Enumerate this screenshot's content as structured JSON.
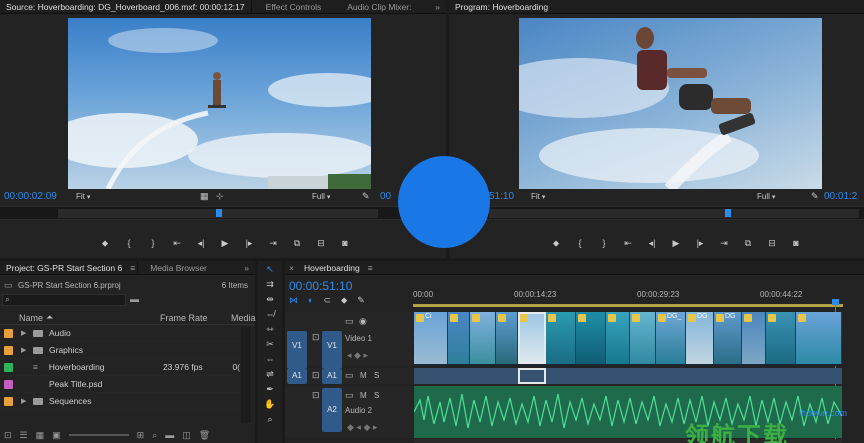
{
  "source_monitor": {
    "tab_title": "Source: Hoverboarding: DG_Hoverboard_006.mxf: 00:00:12:17",
    "tab_effect_controls": "Effect Controls",
    "tab_audio_clip_mixer": "Audio Clip Mixer:",
    "more": "»",
    "timecode": "00:00:02:09",
    "fit_label": "Fit",
    "full_label": "Full",
    "duration_partial": "00"
  },
  "program_monitor": {
    "tab_title": "Program: Hoverboarding",
    "timecode_partial": "51:10",
    "fit_label": "Fit",
    "full_label": "Full",
    "duration_partial": "00:01:2"
  },
  "transport_icons": [
    "marker-icon",
    "in-point-icon",
    "out-point-icon",
    "go-to-in-icon",
    "step-back-icon",
    "play-icon",
    "step-forward-icon",
    "go-to-out-icon",
    "insert-icon",
    "overwrite-icon",
    "export-frame-icon"
  ],
  "project": {
    "tab_title": "Project: GS-PR Start Section 6",
    "tab_media_browser": "Media Browser",
    "filename": "GS-PR Start Section 6.prproj",
    "item_count": "6 Items",
    "col_name": "Name",
    "col_frame_rate": "Frame Rate",
    "col_media": "Media",
    "items": [
      {
        "name": "Audio",
        "type": "folder",
        "color": "#e8a03c",
        "rate": "",
        "extra": ""
      },
      {
        "name": "Graphics",
        "type": "folder",
        "color": "#e8a03c",
        "rate": "",
        "extra": ""
      },
      {
        "name": "Hoverboarding",
        "type": "sequence",
        "color": "#2fb35a",
        "rate": "23.976 fps",
        "extra": "0("
      },
      {
        "name": "Peak Title.psd",
        "type": "file",
        "color": "#c45ec0",
        "rate": "",
        "extra": ""
      },
      {
        "name": "Sequences",
        "type": "folder",
        "color": "#e8a03c",
        "rate": "",
        "extra": ""
      }
    ]
  },
  "timeline": {
    "tab_title": "Hoverboarding",
    "timecode": "00:00:51:10",
    "ruler": [
      "00:00",
      "00:00:14:23",
      "00:00:29:23",
      "00:00:44:22"
    ],
    "tracks": {
      "v1_src": "V1",
      "v1": "V1",
      "v1_name": "Video 1",
      "a1_src": "A1",
      "a1": "A1",
      "a2": "A2",
      "a2_name": "Audio 2",
      "m": "M",
      "s": "S"
    },
    "clip_labels": [
      "Ci",
      "Di",
      "DG_",
      "DG",
      "DG"
    ]
  },
  "watermark": {
    "domain": "lhdown.com",
    "chinese": "领航下载"
  }
}
